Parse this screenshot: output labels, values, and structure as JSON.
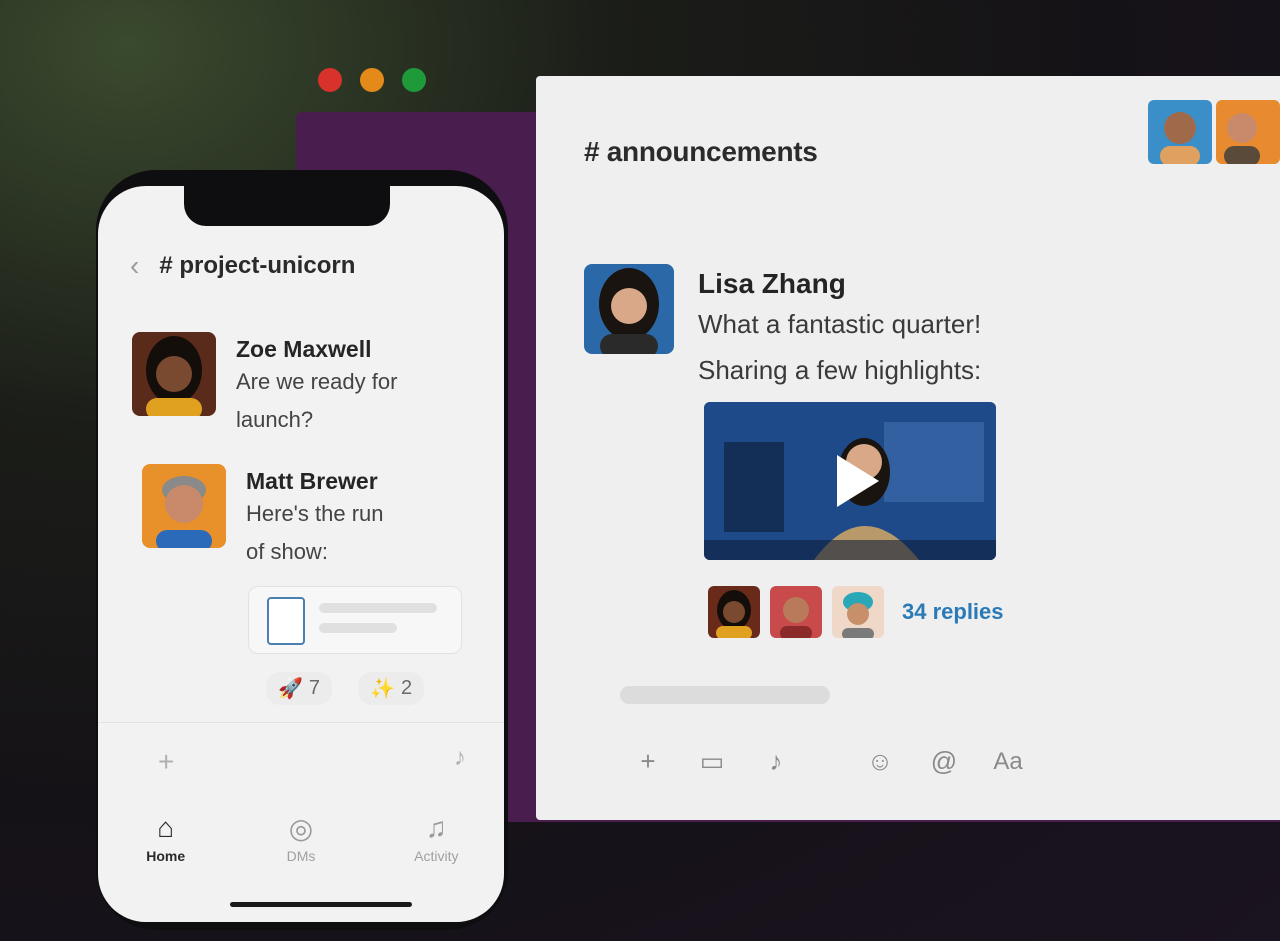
{
  "desktop": {
    "channel": "# announcements",
    "message": {
      "author": "Lisa Zhang",
      "lines": [
        "What a fantastic quarter!",
        "Sharing a few highlights:"
      ],
      "replies": "34 replies"
    },
    "composer": {
      "tools": [
        "plus-icon",
        "video-icon",
        "mic-icon",
        "emoji-icon",
        "mention-icon",
        "format-text-icon"
      ],
      "format_label": "Aa"
    }
  },
  "phone": {
    "channel": "# project-unicorn",
    "messages": [
      {
        "author": "Zoe Maxwell",
        "text_lines": [
          "Are we ready for",
          "launch?"
        ]
      },
      {
        "author": "Matt Brewer",
        "text_lines": [
          "Here's the run",
          "of show:"
        ]
      }
    ],
    "reactions": [
      {
        "icon": "rocket-icon",
        "count": "7"
      },
      {
        "icon": "sparkles-icon",
        "count": "2"
      }
    ],
    "tabs": [
      {
        "label": "Home",
        "icon": "home-icon",
        "active": true
      },
      {
        "label": "DMs",
        "icon": "dms-icon",
        "active": false
      },
      {
        "label": "Activity",
        "icon": "bell-icon",
        "active": false
      }
    ]
  },
  "colors": {
    "accent_purple": "#4a1d4f",
    "link_blue": "#2a7ab8",
    "window_red": "#d8322a",
    "window_yellow": "#e38a1a",
    "window_green": "#1f9a3a"
  }
}
